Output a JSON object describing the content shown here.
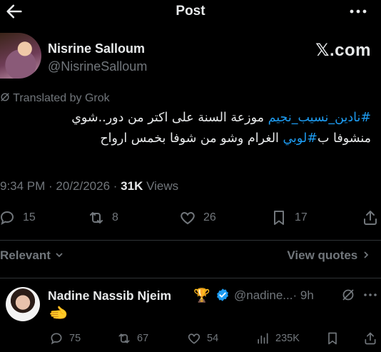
{
  "header": {
    "title": "Post",
    "back_icon": "arrow-left-icon",
    "more_icon": "more-horizontal-icon"
  },
  "author": {
    "name": "Nisrine Salloum",
    "handle": "@NisrineSalloum",
    "source_label": "𝕏.com"
  },
  "translated_label": "Translated by Grok",
  "post": {
    "hashtag1": "#نادين_نسيب_نجيم",
    "line1_rest": " موزعة السنة على اكتر من دور..شوي",
    "line2_start": "منشوفا ب",
    "hashtag2": "#لوبي",
    "line2_rest": " الغرام وشو من شوفا بخمس ارواح"
  },
  "meta": {
    "time": "9:34 PM",
    "date": "20/2/2026",
    "views_count": "31K",
    "views_label": "Views"
  },
  "stats": {
    "replies": "15",
    "reposts": "8",
    "likes": "26",
    "bookmarks": "17"
  },
  "filters": {
    "sort_label": "Relevant",
    "view_quotes_label": "View quotes"
  },
  "reply": {
    "name": "Nadine Nassib Njeim",
    "badge_emoji": "🏆",
    "handle": "@nadine...",
    "age": "· 9h",
    "content_emoji": "🫲",
    "replies": "75",
    "reposts": "67",
    "likes": "54",
    "views": "235K"
  },
  "colors": {
    "background": "#000000",
    "text": "#e7e9ea",
    "muted": "#71767b",
    "accent": "#1d9bf0",
    "divider": "#2f3336"
  }
}
